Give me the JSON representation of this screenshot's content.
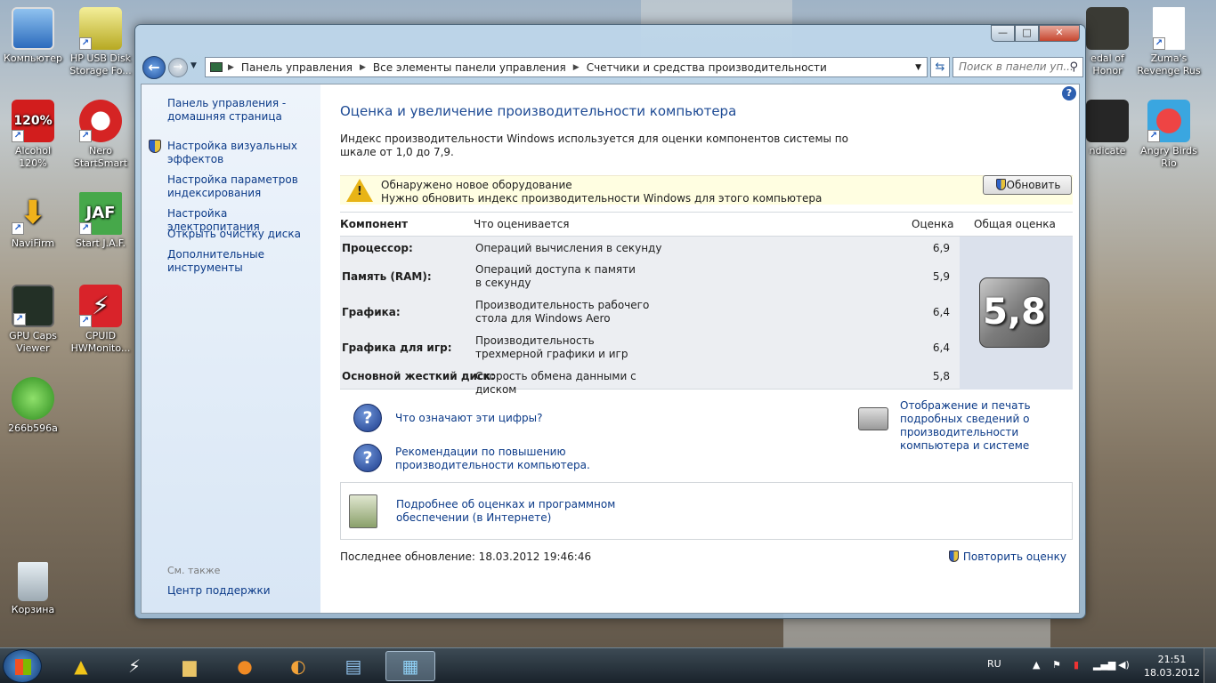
{
  "desktop": {
    "icons": [
      {
        "label": "Компьютер"
      },
      {
        "label": "HP USB Disk Storage Fo..."
      },
      {
        "label": "Alcohol 120%"
      },
      {
        "label": "Nero StartSmart"
      },
      {
        "label": "NaviFirm"
      },
      {
        "label": "Start J.A.F."
      },
      {
        "label": "GPU Caps Viewer"
      },
      {
        "label": "CPUID HWMonito..."
      },
      {
        "label": "266b596a"
      },
      {
        "label": "Корзина"
      },
      {
        "label": "edal of Honor"
      },
      {
        "label": "Zuma's Revenge Rus"
      },
      {
        "label": "ndicate"
      },
      {
        "label": "Angry Birds Rio"
      }
    ],
    "badge_texts": {
      "alcohol": "120%",
      "jaf": "JAF"
    }
  },
  "window": {
    "caption": {
      "minimize": "—",
      "maximize": "□",
      "close": "✕"
    },
    "address": {
      "crumbs": [
        "Панель управления",
        "Все элементы панели управления",
        "Счетчики и средства производительности"
      ]
    },
    "search_placeholder": "Поиск в панели уп...",
    "left_pane": {
      "home": "Панель управления - домашняя страница",
      "links": [
        "Настройка визуальных эффектов",
        "Настройка параметров индексирования",
        "Настройка электропитания",
        "Открыть очистку диска",
        "Дополнительные инструменты"
      ],
      "see_also": "См. также",
      "support": "Центр поддержки"
    },
    "main": {
      "title": "Оценка и увеличение производительности компьютера",
      "description": "Индекс производительности Windows используется для оценки компонентов системы по шкале от 1,0 до 7,9.",
      "notice": {
        "line1": "Обнаружено новое оборудование",
        "line2": "Нужно обновить индекс производительности Windows для этого компьютера",
        "button": "Обновить"
      },
      "table": {
        "headers": {
          "component": "Компонент",
          "what": "Что оценивается",
          "score": "Оценка",
          "base": "Общая оценка"
        },
        "rows": [
          {
            "component": "Процессор:",
            "what": "Операций вычисления в секунду",
            "score": "6,9"
          },
          {
            "component": "Память (RAM):",
            "what": "Операций доступа к памяти в секунду",
            "score": "5,9"
          },
          {
            "component": "Графика:",
            "what": "Производительность рабочего стола для Windows Aero",
            "score": "6,4"
          },
          {
            "component": "Графика для игр:",
            "what": "Производительность трехмерной графики и игр",
            "score": "6,4"
          },
          {
            "component": "Основной жесткий диск:",
            "what": "Скорость обмена данными с диском",
            "score": "5,8"
          }
        ],
        "base_score": "5,8"
      },
      "links": {
        "what_mean": "Что означают эти цифры?",
        "tips": "Рекомендации по повышению производительности компьютера.",
        "print": "Отображение и печать подробных сведений о производительности компьютера и системе",
        "online": "Подробнее об оценках и программном обеспечении (в Интернете)"
      },
      "last_update": "Последнее обновление: 18.03.2012 19:46:46",
      "rerun": "Повторить оценку"
    }
  },
  "taskbar": {
    "lang": "RU",
    "time": "21:51",
    "date": "18.03.2012"
  }
}
